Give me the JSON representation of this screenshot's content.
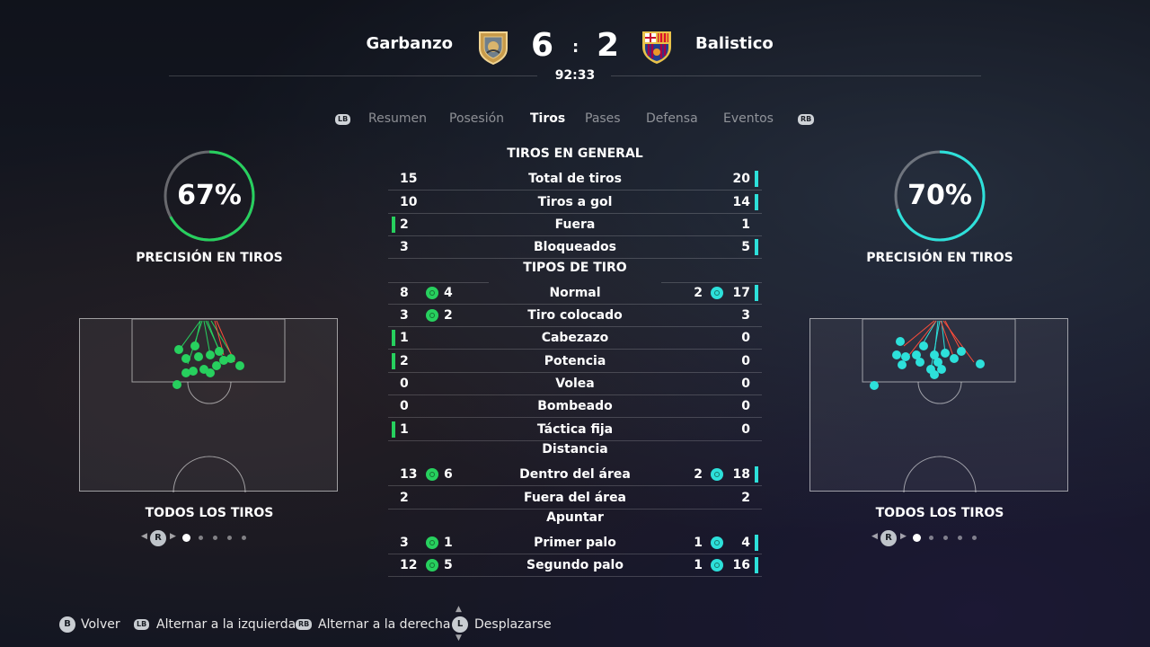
{
  "match": {
    "home_team": "Garbanzo",
    "away_team": "Balistico",
    "home_score": "6",
    "score_separator": ":",
    "away_score": "2",
    "clock": "92:33"
  },
  "tabs": {
    "lb": "LB",
    "rb": "RB",
    "items": [
      "Resumen",
      "Posesión",
      "Tiros",
      "Pases",
      "Defensa",
      "Eventos"
    ],
    "active": "Tiros"
  },
  "home_panel": {
    "accuracy": "67%",
    "accuracy_fraction": 0.67,
    "accuracy_label": "PRECISIÓN EN TIROS",
    "shots_label": "TODOS LOS TIROS",
    "pager_button": "R"
  },
  "away_panel": {
    "accuracy": "70%",
    "accuracy_fraction": 0.7,
    "accuracy_label": "PRECISIÓN EN TIROS",
    "shots_label": "TODOS LOS TIROS",
    "pager_button": "R"
  },
  "stats": {
    "sections": [
      {
        "title": "TIROS EN GENERAL",
        "rows": [
          {
            "label": "Total de tiros",
            "home": "15",
            "away": "20",
            "lead": "away"
          },
          {
            "label": "Tiros a gol",
            "home": "10",
            "away": "14",
            "lead": "away"
          },
          {
            "label": "Fuera",
            "home": "2",
            "away": "1",
            "lead": "home"
          },
          {
            "label": "Bloqueados",
            "home": "3",
            "away": "5",
            "lead": "away"
          }
        ]
      },
      {
        "title": "TIPOS DE TIRO",
        "rows": [
          {
            "label": "Normal",
            "home": "8",
            "home_goals": "4",
            "away": "17",
            "away_goals": "2",
            "lead": "away"
          },
          {
            "label": "Tiro colocado",
            "home": "3",
            "home_goals": "2",
            "away": "3",
            "lead": ""
          },
          {
            "label": "Cabezazo",
            "home": "1",
            "away": "0",
            "lead": "home"
          },
          {
            "label": "Potencia",
            "home": "2",
            "away": "0",
            "lead": "home"
          },
          {
            "label": "Volea",
            "home": "0",
            "away": "0",
            "lead": ""
          },
          {
            "label": "Bombeado",
            "home": "0",
            "away": "0",
            "lead": ""
          },
          {
            "label": "Táctica fija",
            "home": "1",
            "away": "0",
            "lead": "home"
          }
        ]
      },
      {
        "title": "Distancia",
        "rows": [
          {
            "label": "Dentro del área",
            "home": "13",
            "home_goals": "6",
            "away": "18",
            "away_goals": "2",
            "lead": "away"
          },
          {
            "label": "Fuera del área",
            "home": "2",
            "away": "2",
            "lead": ""
          }
        ]
      },
      {
        "title": "Apuntar",
        "rows": [
          {
            "label": "Primer palo",
            "home": "3",
            "home_goals": "1",
            "away": "4",
            "away_goals": "1",
            "lead": "away"
          },
          {
            "label": "Segundo palo",
            "home": "12",
            "home_goals": "5",
            "away": "16",
            "away_goals": "1",
            "lead": "away"
          }
        ]
      }
    ]
  },
  "footer": {
    "back_button": "B",
    "back_label": "Volver",
    "left_button": "LB",
    "left_label": "Alternar a la izquierda",
    "right_button": "RB",
    "right_label": "Alternar a la derecha",
    "scroll_button": "L",
    "scroll_label": "Desplazarse"
  },
  "colors": {
    "home": "#27d05e",
    "away": "#2de0da"
  }
}
